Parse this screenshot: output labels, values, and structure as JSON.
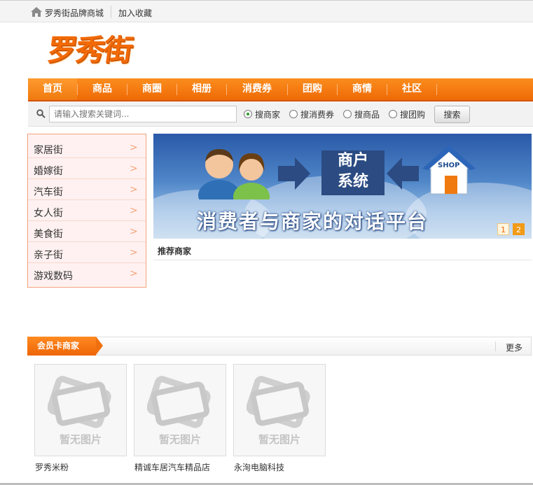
{
  "topbar": {
    "site_name": "罗秀街品牌商城",
    "bookmark": "加入收藏"
  },
  "logo": {
    "text": "罗秀街"
  },
  "nav": {
    "items": [
      "首页",
      "商品",
      "商圈",
      "相册",
      "消费券",
      "团购",
      "商情",
      "社区"
    ],
    "active_index": 0
  },
  "search": {
    "placeholder": "请输入搜索关键词...",
    "options": [
      "搜商家",
      "搜消费券",
      "搜商品",
      "搜团购"
    ],
    "selected_index": 0,
    "button_label": "搜索"
  },
  "categories": {
    "items": [
      "家居街",
      "婚嫁街",
      "汽车街",
      "女人街",
      "美食街",
      "亲子街",
      "游戏数码"
    ],
    "arrow": ">"
  },
  "banner": {
    "box_line1": "商户",
    "box_line2": "系统",
    "shop_label": "SHOP",
    "slogan": "消费者与商家的对话平台",
    "pages": [
      "1",
      "2"
    ],
    "active_page": 1
  },
  "recommend": {
    "title": "推荐商家"
  },
  "member_section": {
    "title": "会员卡商家",
    "more": "更多",
    "cards": [
      {
        "placeholder": "暂无图片",
        "name": "罗秀米粉"
      },
      {
        "placeholder": "暂无图片",
        "name": "精诚车居汽车精品店"
      },
      {
        "placeholder": "暂无图片",
        "name": "永洵电脑科技"
      }
    ]
  },
  "colors": {
    "accent": "#f26a07",
    "nav_bg": "#ee6a05",
    "category_bg": "#fff1f1",
    "category_border": "#f2a37a"
  }
}
